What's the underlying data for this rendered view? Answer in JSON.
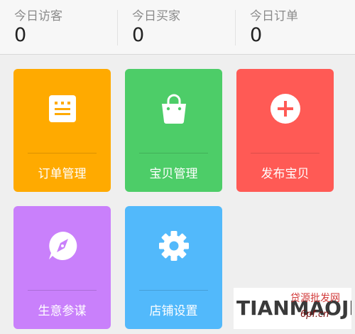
{
  "stats": [
    {
      "label": "今日访客",
      "value": "0"
    },
    {
      "label": "今日买家",
      "value": "0"
    },
    {
      "label": "今日订单",
      "value": "0"
    }
  ],
  "tiles": [
    {
      "label": "订单管理",
      "icon": "order-list-icon",
      "color": "#ffaa00"
    },
    {
      "label": "宝贝管理",
      "icon": "shopping-bag-icon",
      "color": "#4dcd68"
    },
    {
      "label": "发布宝贝",
      "icon": "plus-circle-icon",
      "color": "#ff5a55"
    },
    {
      "label": "生意参谋",
      "icon": "compass-icon",
      "color": "#c980fb"
    },
    {
      "label": "店铺设置",
      "icon": "gear-icon",
      "color": "#52b9fb"
    }
  ],
  "watermark": {
    "text": "TIANMAOJI",
    "overlay": "贷源批发网",
    "sub": "6pf.cn"
  }
}
